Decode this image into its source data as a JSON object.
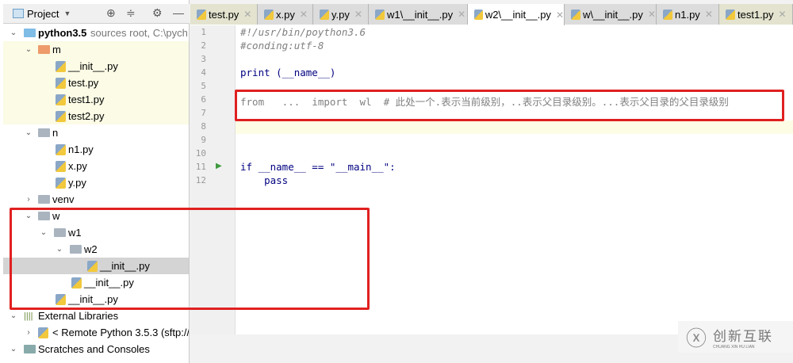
{
  "project_panel": {
    "title": "Project",
    "tree": [
      {
        "label": "python3.5",
        "suffix": "sources root,  C:\\pych",
        "kind": "root"
      },
      {
        "label": "m",
        "kind": "folder-orange"
      },
      {
        "label": "__init__.py",
        "kind": "py"
      },
      {
        "label": "test.py",
        "kind": "py"
      },
      {
        "label": "test1.py",
        "kind": "py"
      },
      {
        "label": "test2.py",
        "kind": "py"
      },
      {
        "label": "n",
        "kind": "folder"
      },
      {
        "label": "n1.py",
        "kind": "py"
      },
      {
        "label": "x.py",
        "kind": "py"
      },
      {
        "label": "y.py",
        "kind": "py"
      },
      {
        "label": "venv",
        "kind": "folder"
      },
      {
        "label": "w",
        "kind": "folder"
      },
      {
        "label": "w1",
        "kind": "folder"
      },
      {
        "label": "w2",
        "kind": "folder"
      },
      {
        "label": "__init__.py",
        "kind": "py",
        "selected": true
      },
      {
        "label": "__init__.py",
        "kind": "py"
      },
      {
        "label": "__init__.py",
        "kind": "py"
      },
      {
        "label": "External Libraries",
        "kind": "lib"
      },
      {
        "label": "< Remote Python 3.5.3 (sftp://",
        "kind": "python"
      },
      {
        "label": "Scratches and Consoles",
        "kind": "scratch"
      }
    ]
  },
  "tabs": [
    "test.py",
    "x.py",
    "y.py",
    "w1\\__init__.py",
    "w2\\__init__.py",
    "w\\__init__.py",
    "n1.py",
    "test1.py"
  ],
  "active_tab": "w2\\__init__.py",
  "code_lines": [
    {
      "n": "1",
      "text": "#!/usr/bin/poython3.6",
      "style": "cmt"
    },
    {
      "n": "2",
      "text": "#conding:utf-8",
      "style": "cmt"
    },
    {
      "n": "3",
      "text": ""
    },
    {
      "n": "4",
      "text": "print (__name__)"
    },
    {
      "n": "5",
      "text": ""
    },
    {
      "n": "6",
      "text": "from   ...  import  wl  # 此处一个.表示当前级别，..表示父目录级别。...表示父目录的父目录级别",
      "style": "gray"
    },
    {
      "n": "7",
      "text": ""
    },
    {
      "n": "8",
      "text": ""
    },
    {
      "n": "9",
      "text": ""
    },
    {
      "n": "10",
      "text": ""
    },
    {
      "n": "11",
      "text": "if __name__ == \"__main__\":"
    },
    {
      "n": "12",
      "text": "    pass"
    }
  ],
  "watermark": {
    "text": "创新互联",
    "sub": "CHUANG XIN HU LIAN"
  },
  "colors": {
    "highlight": "#e02020",
    "selected_row": "#d4d4d4"
  }
}
